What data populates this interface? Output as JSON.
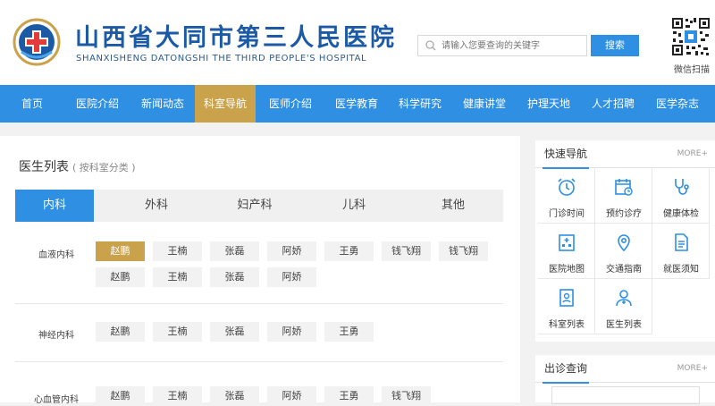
{
  "header": {
    "title_cn": "山西省大同市第三人民医院",
    "title_en": "SHANXISHENG DATONGSHI THE THIRD PEOPLE'S HOSPITAL",
    "search_placeholder": "请输入您要查询的关键字",
    "search_button": "搜索",
    "qr_label": "微信扫描"
  },
  "nav": {
    "items": [
      "首页",
      "医院介绍",
      "新闻动态",
      "科室导航",
      "医师介绍",
      "医学教育",
      "科学研究",
      "健康讲堂",
      "护理天地",
      "人才招聘",
      "医学杂志"
    ],
    "active_index": 3
  },
  "main": {
    "title": "医生列表",
    "subtitle": "( 按科室分类 )",
    "tabs": [
      "内科",
      "外科",
      "妇产科",
      "儿科",
      "其他"
    ],
    "active_tab": 0,
    "departments": [
      {
        "name": "血液内科",
        "doctors": [
          "赵鹏",
          "王楠",
          "张磊",
          "阿娇",
          "王勇",
          "钱飞翔",
          "钱飞翔",
          "赵鹏",
          "王楠",
          "张磊",
          "阿娇"
        ]
      },
      {
        "name": "神经内科",
        "doctors": [
          "赵鹏",
          "王楠",
          "张磊",
          "阿娇",
          "王勇"
        ]
      },
      {
        "name": "心血管内科",
        "doctors": [
          "赵鹏",
          "王楠",
          "张磊",
          "阿娇",
          "王勇",
          "钱飞翔"
        ]
      }
    ]
  },
  "sidebar": {
    "quick_nav": {
      "title": "快速导航",
      "more": "MORE+",
      "items": [
        {
          "label": "门诊时间",
          "icon": "alarm-clock-icon"
        },
        {
          "label": "预约诊疗",
          "icon": "calendar-clock-icon"
        },
        {
          "label": "健康体检",
          "icon": "stethoscope-icon"
        },
        {
          "label": "医院地图",
          "icon": "hospital-building-icon"
        },
        {
          "label": "交通指南",
          "icon": "map-pin-icon"
        },
        {
          "label": "就医须知",
          "icon": "document-icon"
        },
        {
          "label": "科室列表",
          "icon": "id-card-icon"
        },
        {
          "label": "医生列表",
          "icon": "doctor-icon"
        }
      ]
    },
    "schedule": {
      "title": "出诊查询",
      "more": "MORE+"
    }
  },
  "colors": {
    "primary": "#2e8fe3",
    "accent_gold": "#c9a24b",
    "title_blue": "#1d5aa6"
  }
}
